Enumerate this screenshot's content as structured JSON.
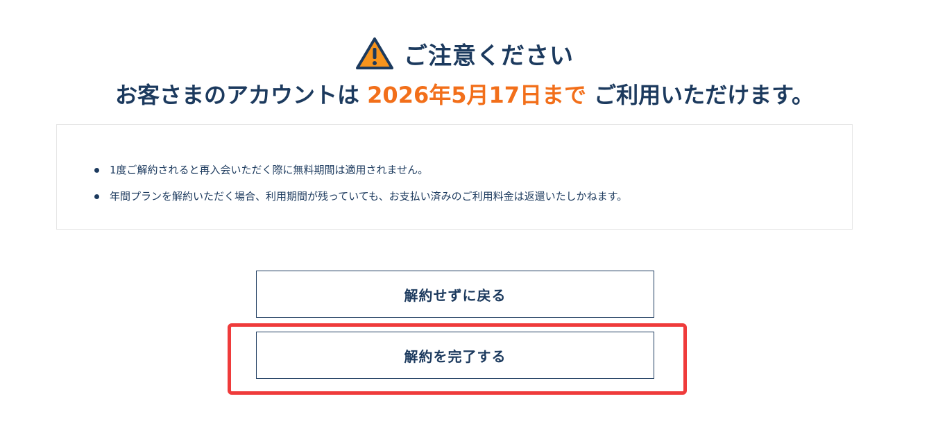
{
  "heading": {
    "icon": "warning-triangle-icon",
    "title": "ご注意ください"
  },
  "subheading": {
    "prefix": "お客さまのアカウントは ",
    "date_highlight": "2026年5月17日まで",
    "suffix": " ご利用いただけます。"
  },
  "notices": [
    "1度ご解約されると再入会いただく際に無料期間は適用されません。",
    "年間プランを解約いただく場合、利用期間が残っていても、お支払い済みのご利用料金は返還いたしかねます。"
  ],
  "buttons": {
    "back_label": "解約せずに戻る",
    "complete_label": "解約を完了する"
  },
  "colors": {
    "text": "#1c3a5e",
    "accent": "#f26f1a",
    "warning_fill": "#f7941d",
    "highlight_frame": "#ef3b3b"
  }
}
